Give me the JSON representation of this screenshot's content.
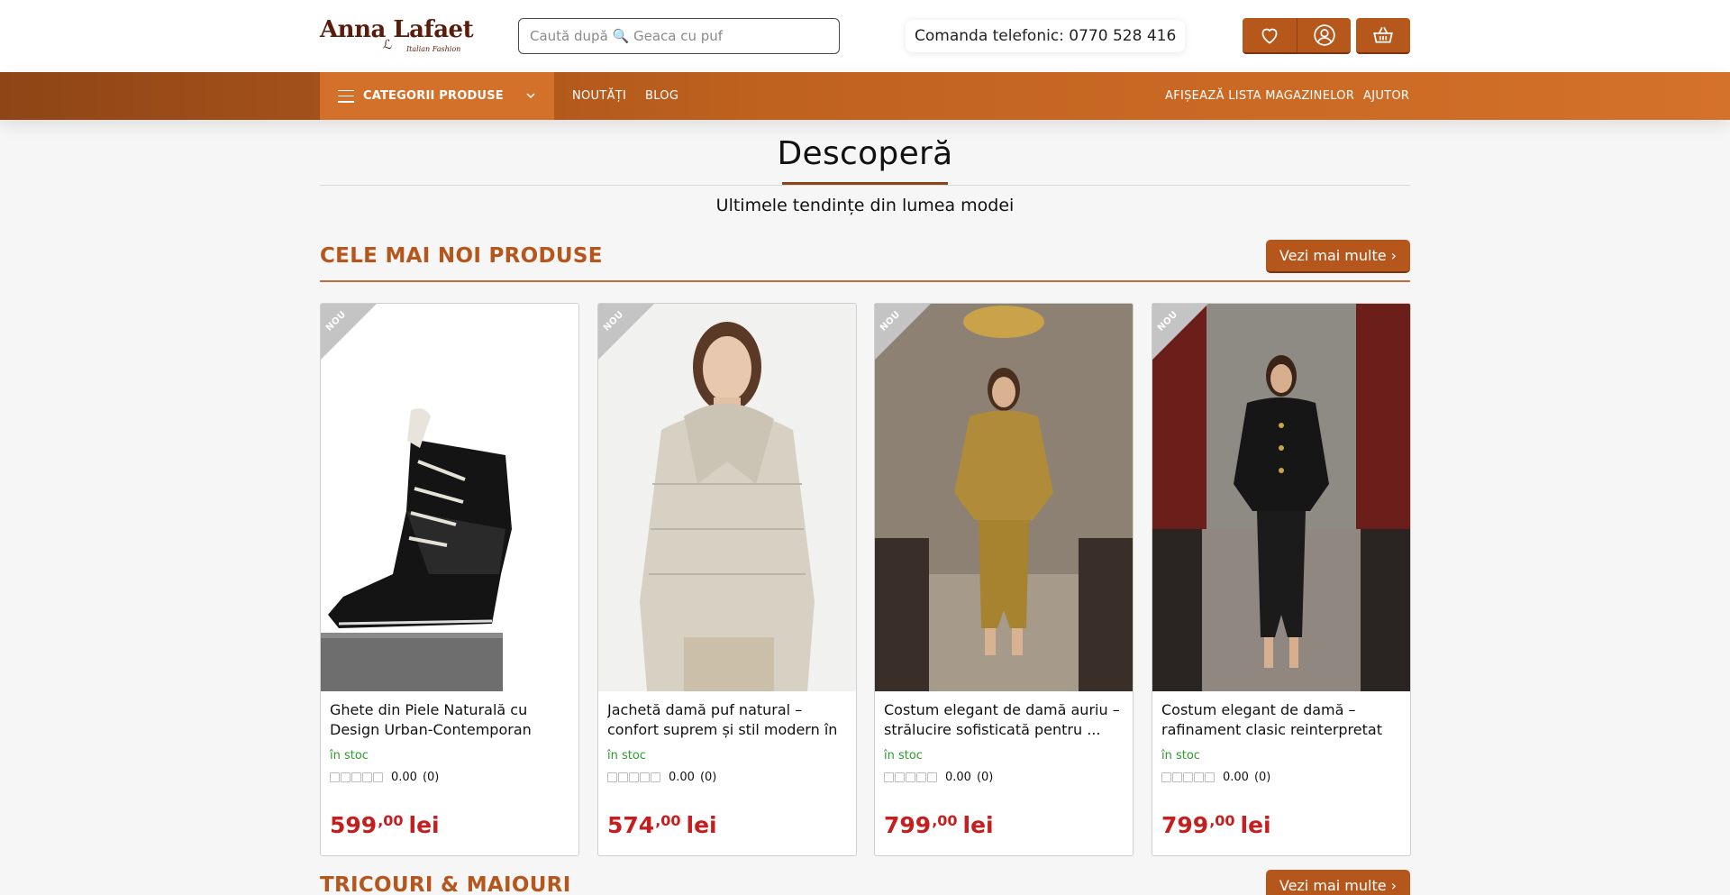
{
  "header": {
    "logo_text": "Anna Lafaet",
    "logo_tagline": "Italian Fashion",
    "search_placeholder": "Caută după 🔍 Geaca cu puf",
    "phone": "Comanda telefonic: 0770 528 416",
    "icons": [
      "heart-icon",
      "user-icon",
      "basket-icon"
    ]
  },
  "nav": {
    "categories_label": "CATEGORII PRODUSE",
    "left_links": [
      "NOUTĂȚI",
      "BLOG"
    ],
    "right_links": [
      "AFIȘEAZĂ LISTA MAGAZINELOR",
      "AJUTOR"
    ]
  },
  "discover": {
    "title": "Descoperă",
    "subtitle": "Ultimele tendințe din lumea modei"
  },
  "sections": [
    {
      "title": "CELE MAI NOI PRODUSE",
      "more_label": "Vezi mai multe ›",
      "products": [
        {
          "badge": "NOU",
          "name": "Ghete din Piele Naturală cu Design Urban-Contemporan",
          "stock": "în stoc",
          "rating": "0.00",
          "reviews": "(0)",
          "price_int": "599",
          "price_dec": ",00",
          "currency": "lei"
        },
        {
          "badge": "NOU",
          "name": "Jachetă damă puf natural – confort suprem și stil modern în ...",
          "stock": "în stoc",
          "rating": "0.00",
          "reviews": "(0)",
          "price_int": "574",
          "price_dec": ",00",
          "currency": "lei"
        },
        {
          "badge": "NOU",
          "name": "Costum elegant de damă auriu – strălucire sofisticată pentru ...",
          "stock": "în stoc",
          "rating": "0.00",
          "reviews": "(0)",
          "price_int": "799",
          "price_dec": ",00",
          "currency": "lei"
        },
        {
          "badge": "NOU",
          "name": "Costum elegant de damă – rafinament clasic reinterpretat",
          "stock": "în stoc",
          "rating": "0.00",
          "reviews": "(0)",
          "price_int": "799",
          "price_dec": ",00",
          "currency": "lei"
        }
      ]
    },
    {
      "title": "TRICOURI & MAIOURI",
      "more_label": "Vezi mai multe ›"
    }
  ],
  "colors": {
    "accent": "#b5571d",
    "price": "#c51e1e",
    "stock": "#2f9a2f"
  }
}
